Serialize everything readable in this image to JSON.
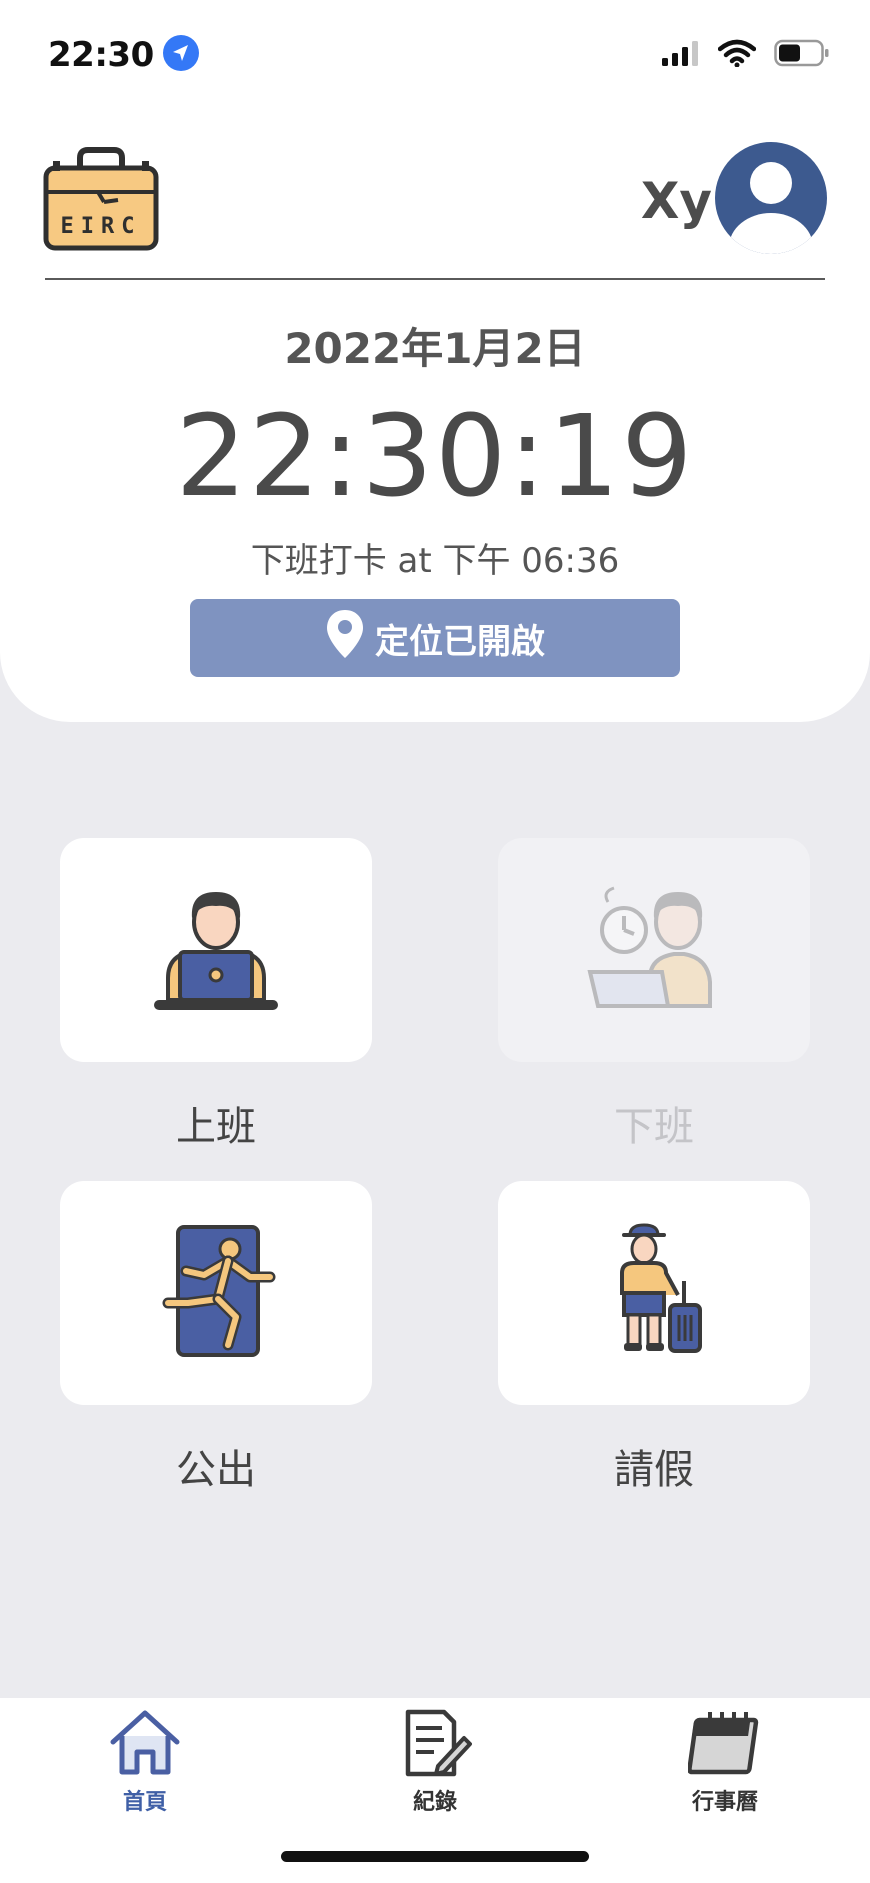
{
  "status_bar": {
    "time": "22:30",
    "icons": [
      "location-arrow-icon",
      "cellular-signal-icon",
      "wifi-icon",
      "battery-icon"
    ]
  },
  "header": {
    "logo_text": "EIRC",
    "user_name": "Xy",
    "avatar_icon": "user-avatar-icon"
  },
  "clock_panel": {
    "date": "2022年1月2日",
    "time": "22:30:19",
    "last_punch": "下班打卡 at  下午 06:36",
    "location_status": "定位已開啟",
    "location_icon": "map-pin-icon"
  },
  "actions": [
    {
      "label": "上班",
      "icon": "worker-at-laptop-icon",
      "enabled": true
    },
    {
      "label": "下班",
      "icon": "worker-clock-off-icon",
      "enabled": false
    },
    {
      "label": "公出",
      "icon": "person-running-out-door-icon",
      "enabled": true
    },
    {
      "label": "請假",
      "icon": "traveler-with-suitcase-icon",
      "enabled": true
    }
  ],
  "bottom_nav": [
    {
      "label": "首頁",
      "icon": "home-icon",
      "active": true
    },
    {
      "label": "紀錄",
      "icon": "document-edit-icon",
      "active": false
    },
    {
      "label": "行事曆",
      "icon": "calendar-icon",
      "active": false
    }
  ],
  "colors": {
    "accent": "#7f93c0",
    "avatar": "#3d5a8f",
    "tile_blue": "#4a5fa3",
    "tile_yellow": "#f5c77e",
    "background": "#ebebef"
  }
}
